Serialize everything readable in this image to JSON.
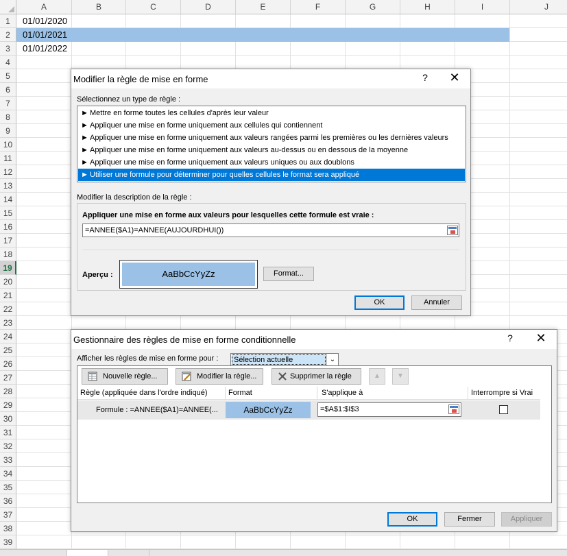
{
  "spreadsheet": {
    "columns": [
      "A",
      "B",
      "C",
      "D",
      "E",
      "F",
      "G",
      "H",
      "I",
      "J"
    ],
    "rows": [
      "1",
      "2",
      "3",
      "4",
      "5",
      "6",
      "7",
      "8",
      "9",
      "10",
      "11",
      "12",
      "13",
      "14",
      "15",
      "16",
      "17",
      "18",
      "19",
      "20",
      "21",
      "22",
      "23",
      "24",
      "25",
      "26",
      "27",
      "28",
      "29",
      "30",
      "31",
      "32",
      "33",
      "34",
      "35",
      "36",
      "37",
      "38",
      "39"
    ],
    "active_row": "19",
    "cells": {
      "A1": "01/01/2020",
      "A2": "01/01/2021",
      "A3": "01/01/2022"
    },
    "highlight_color": "#9bc2e6",
    "accent_color": "#217346"
  },
  "edit_rule_dialog": {
    "title": "Modifier la règle de mise en forme",
    "help": "?",
    "close": "✕",
    "select_type_label": "Sélectionnez un type de règle :",
    "rule_types": [
      "Mettre en forme toutes les cellules d'après leur valeur",
      "Appliquer une mise en forme uniquement aux cellules qui contiennent",
      "Appliquer une mise en forme uniquement aux valeurs rangées parmi les premières ou les dernières valeurs",
      "Appliquer une mise en forme uniquement aux valeurs au-dessus ou en dessous de la moyenne",
      "Appliquer une mise en forme uniquement aux valeurs uniques ou aux doublons",
      "Utiliser une formule pour déterminer pour quelles cellules le format sera appliqué"
    ],
    "selected_rule_index": 5,
    "edit_description_label": "Modifier la description de la règle :",
    "formula_label": "Appliquer une mise en forme aux valeurs pour lesquelles cette formule est vraie :",
    "formula_value": "=ANNEE($A1)=ANNEE(AUJOURDHUI())",
    "preview_label": "Aperçu :",
    "preview_text": "AaBbCcYyZz",
    "format_button": "Format...",
    "ok_button": "OK",
    "cancel_button": "Annuler"
  },
  "manager_dialog": {
    "title": "Gestionnaire des règles de mise en forme conditionnelle",
    "help": "?",
    "close": "✕",
    "show_rules_label": "Afficher les règles de mise en forme pour :",
    "show_rules_value": "Sélection actuelle",
    "new_rule_button": "Nouvelle règle...",
    "edit_rule_button": "Modifier la règle...",
    "delete_rule_button": "Supprimer la règle",
    "columns": {
      "rule": "Règle (appliquée dans l'ordre indiqué)",
      "format": "Format",
      "applies_to": "S'applique à",
      "stop_if_true": "Interrompre si Vrai"
    },
    "rules": [
      {
        "rule": "Formule : =ANNEE($A1)=ANNEE(...",
        "format_preview": "AaBbCcYyZz",
        "applies_to": "=$A$1:$I$3",
        "stop_if_true": false
      }
    ],
    "ok_button": "OK",
    "close_button": "Fermer",
    "apply_button": "Appliquer"
  }
}
